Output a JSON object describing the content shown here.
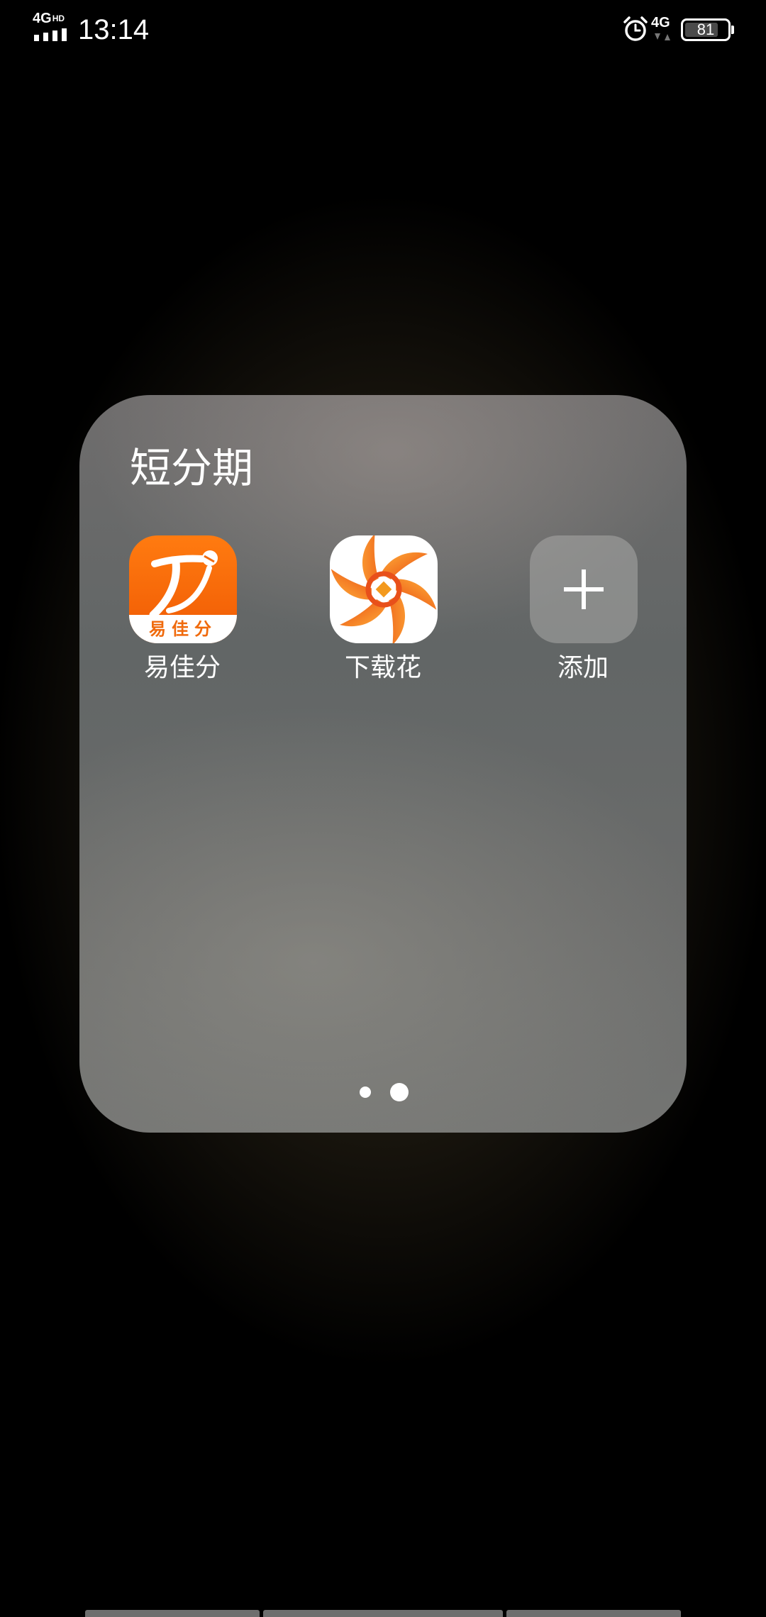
{
  "status_bar": {
    "network_primary": "4G",
    "network_primary_suffix": "HD",
    "time": "13:14",
    "alarm_icon": "alarm-clock-icon",
    "network_secondary": "4G",
    "battery_level": "81",
    "battery_fraction": 0.81
  },
  "folder": {
    "title": "短分期",
    "apps": [
      {
        "label": "易佳分",
        "icon": "yijiafen-app-icon",
        "badge_text": "易佳分",
        "color": "#F26A0A"
      },
      {
        "label": "下载花",
        "icon": "xiazaihua-app-icon",
        "color": "#EE5A12"
      },
      {
        "label": "添加",
        "icon": "plus-icon"
      }
    ],
    "pages": {
      "count": 2,
      "current": 2
    }
  }
}
